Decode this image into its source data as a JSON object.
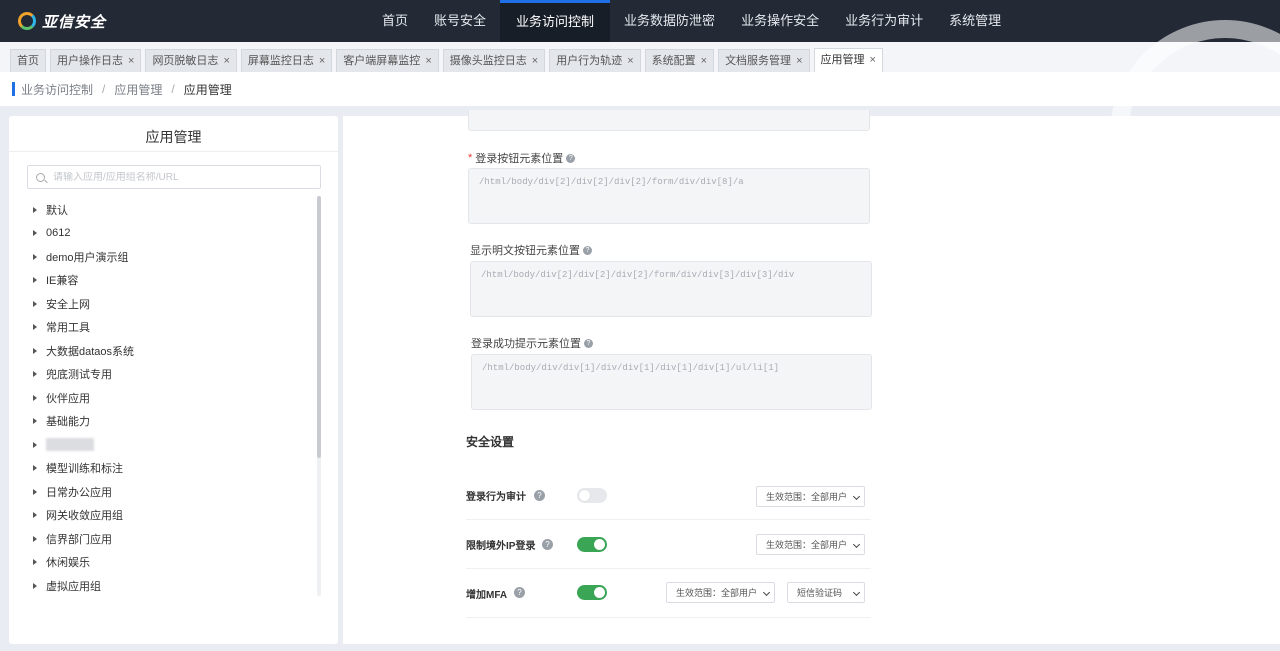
{
  "brand": {
    "name": "亚信安全"
  },
  "topnav": {
    "items": [
      {
        "label": "首页"
      },
      {
        "label": "账号安全"
      },
      {
        "label": "业务访问控制"
      },
      {
        "label": "业务数据防泄密"
      },
      {
        "label": "业务操作安全"
      },
      {
        "label": "业务行为审计"
      },
      {
        "label": "系统管理"
      }
    ],
    "active_index": 2
  },
  "tabs": [
    {
      "label": "首页",
      "closable": false
    },
    {
      "label": "用户操作日志",
      "closable": true
    },
    {
      "label": "网页脱敏日志",
      "closable": true
    },
    {
      "label": "屏幕监控日志",
      "closable": true
    },
    {
      "label": "客户端屏幕监控",
      "closable": true
    },
    {
      "label": "摄像头监控日志",
      "closable": true
    },
    {
      "label": "用户行为轨迹",
      "closable": true
    },
    {
      "label": "系统配置",
      "closable": true
    },
    {
      "label": "文档服务管理",
      "closable": true
    },
    {
      "label": "应用管理",
      "closable": true,
      "active": true
    }
  ],
  "tab_close_symbol": "×",
  "breadcrumb": {
    "level1": "业务访问控制",
    "level2": "应用管理",
    "current": "应用管理",
    "separator": "/"
  },
  "left": {
    "title": "应用管理",
    "search_placeholder": "请输入应用/应用组名称/URL",
    "tree": [
      "默认",
      "0612",
      "demo用户演示组",
      "IE兼容",
      "安全上网",
      "常用工具",
      "大数据dataos系统",
      "兜底测试专用",
      "伙伴应用",
      "基础能力",
      "",
      "模型训练和标注",
      "日常办公应用",
      "网关收敛应用组",
      "信界部门应用",
      "休闲娱乐",
      "虚拟应用组"
    ]
  },
  "form": {
    "fields": [
      {
        "label": "登录按钮元素位置",
        "required": true,
        "value": "/html/body/div[2]/div[2]/div[2]/form/div/div[8]/a"
      },
      {
        "label": "显示明文按钮元素位置",
        "required": false,
        "value": "/html/body/div[2]/div[2]/div[2]/form/div/div[3]/div[3]/div"
      },
      {
        "label": "登录成功提示元素位置",
        "required": false,
        "value": "/html/body/div/div[1]/div/div[1]/div[1]/div[1]/ul/li[1]"
      }
    ],
    "help_symbol": "?"
  },
  "security": {
    "title": "安全设置",
    "rows": [
      {
        "label": "登录行为审计",
        "enabled": false,
        "scope": "生效范围：全部用户"
      },
      {
        "label": "限制境外IP登录",
        "enabled": true,
        "scope": "生效范围：全部用户"
      },
      {
        "label": "增加MFA",
        "enabled": true,
        "scope": "生效范围：全部用户",
        "method": "短信验证码"
      }
    ]
  },
  "colors": {
    "nav_bg": "#232a36",
    "accent": "#1f6fe5",
    "toggle_on": "#3aa655"
  }
}
